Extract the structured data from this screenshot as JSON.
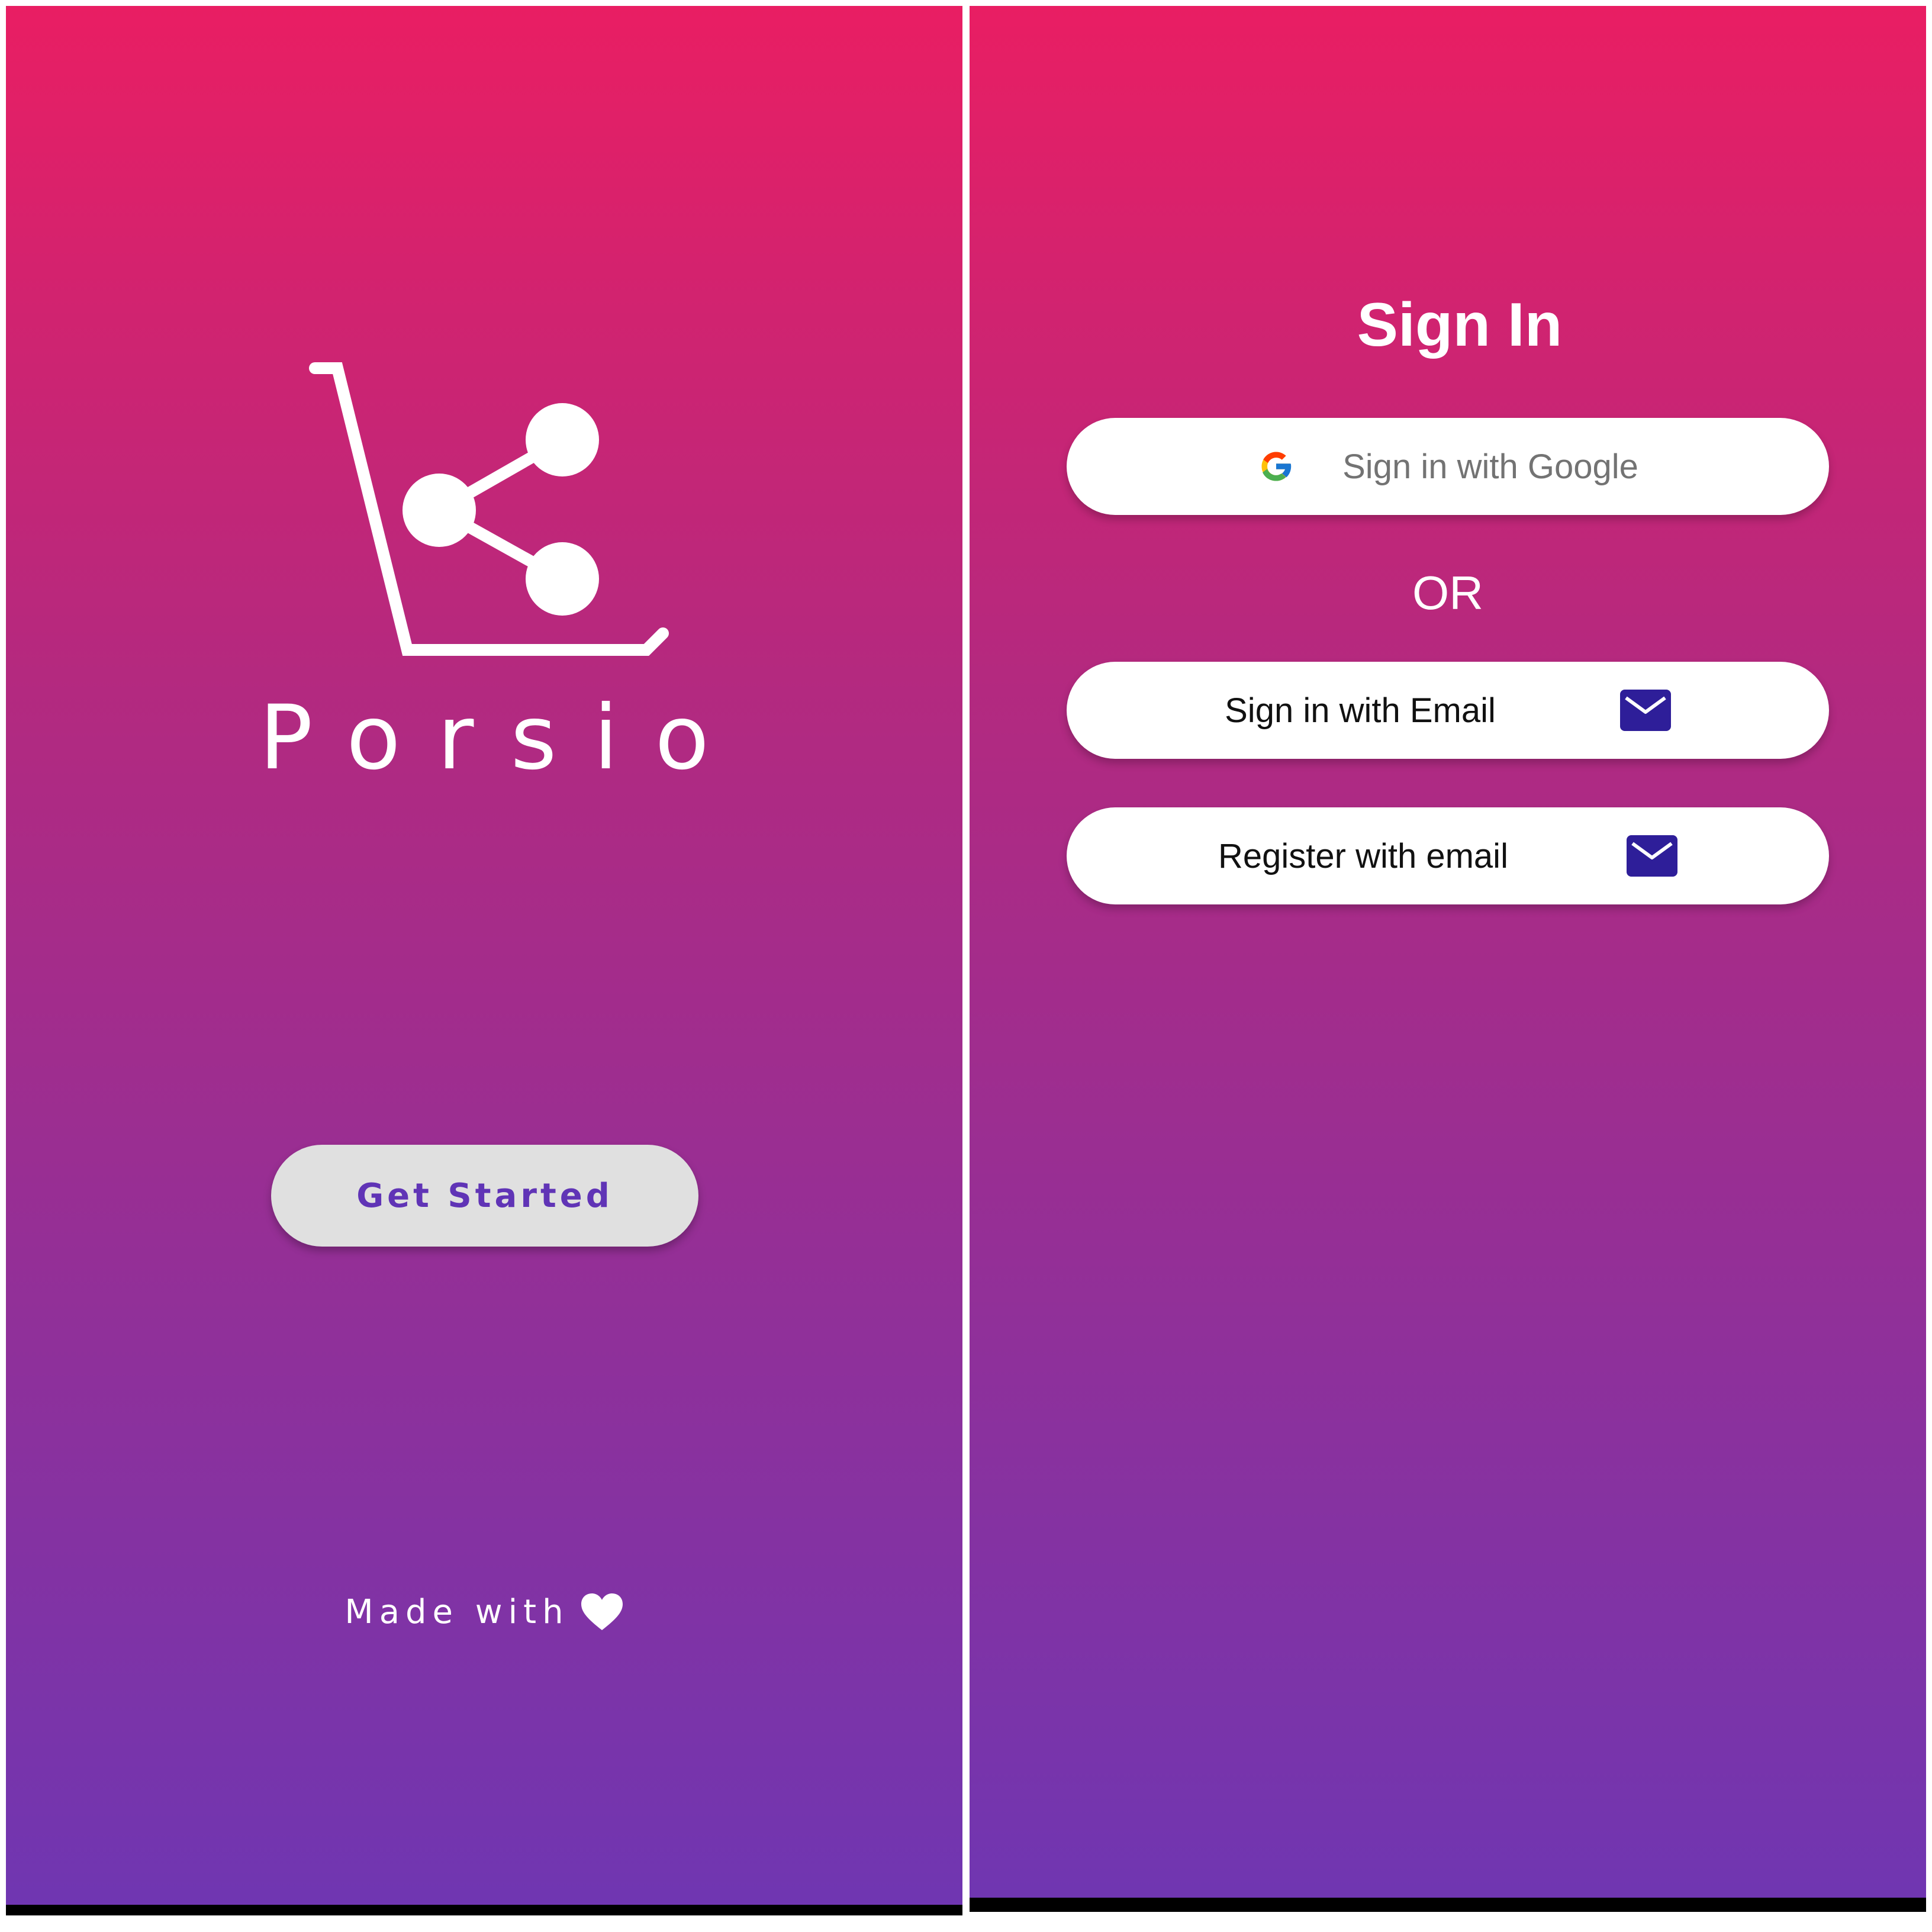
{
  "splash": {
    "brand_name": "Porsio",
    "get_started_label": "Get Started",
    "made_with_text": "Made with",
    "logo_icon": "cart-share-icon",
    "heart_icon": "heart-icon"
  },
  "signin": {
    "title": "Sign In",
    "google_label": "Sign in with Google",
    "or_text": "OR",
    "email_signin_label": "Sign in with Email",
    "register_label": "Register with email",
    "mail_icon": "envelope-icon",
    "google_icon": "google-g-icon"
  },
  "colors": {
    "gradient_top": "#e91e63",
    "gradient_bottom": "#6f36b2",
    "get_started_text": "#6034b6",
    "mail_icon_bg": "#2e1e99",
    "button_bg": "#ffffff"
  }
}
